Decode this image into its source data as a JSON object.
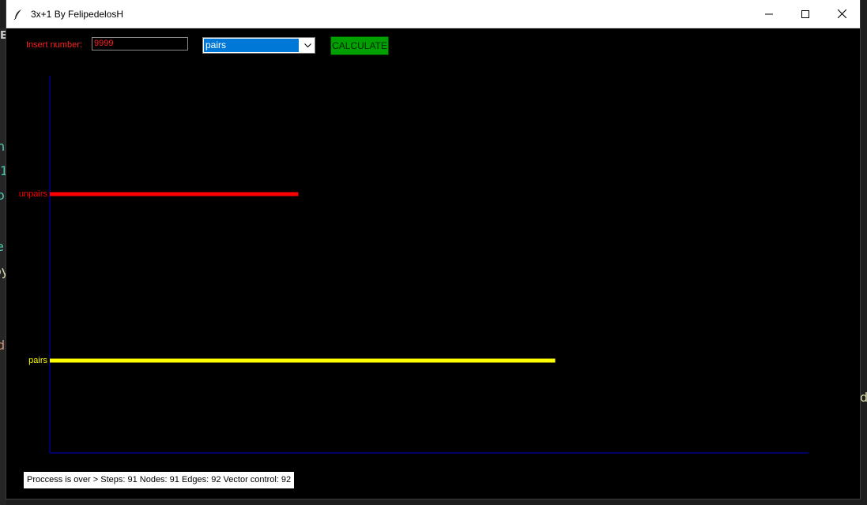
{
  "window": {
    "title": "3x+1 By FelipedelosH",
    "controls": {
      "minimize_icon": "minimize-icon",
      "maximize_icon": "maximize-icon",
      "close_icon": "close-icon"
    }
  },
  "form": {
    "insert_label": "Insert number:",
    "number_value": "9999",
    "mode_select": {
      "selected": "pairs"
    },
    "calculate_label": "CALCULATE"
  },
  "chart_data": {
    "type": "bar",
    "orientation": "horizontal",
    "categories": [
      "unpairs",
      "pairs"
    ],
    "values": [
      30,
      61
    ],
    "max_value": 91,
    "colors": {
      "unpairs": "#ff0000",
      "pairs": "#ffff00",
      "axis": "#0000cc"
    }
  },
  "status": {
    "text": "Proccess is over > Steps: 91 Nodes: 91 Edges: 92 Vector control: 92"
  },
  "background_fragments": [
    "no",
    "1",
    "o",
    "e",
    "oy",
    "d",
    "d",
    "EC"
  ],
  "colors": {
    "accent_red": "#ff2020",
    "button_green": "#00a000",
    "select_blue": "#0078d7",
    "background": "#000000"
  }
}
